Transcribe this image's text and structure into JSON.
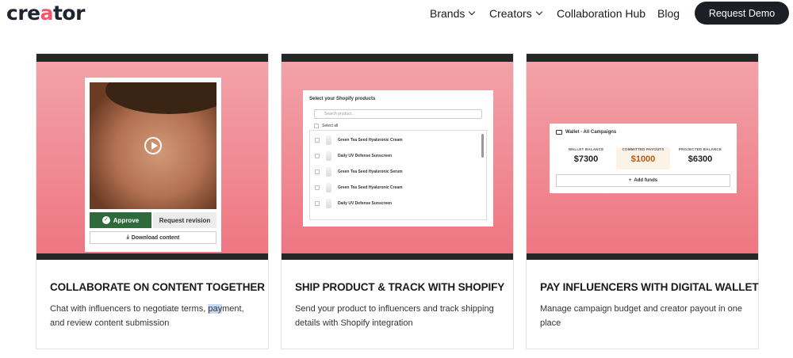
{
  "nav": {
    "logo_main": "cre",
    "logo_accent": "a",
    "logo_tail": "tor",
    "items": [
      {
        "label": "Brands",
        "dropdown": true
      },
      {
        "label": "Creators",
        "dropdown": true
      },
      {
        "label": "Collaboration Hub",
        "dropdown": false
      },
      {
        "label": "Blog",
        "dropdown": false
      }
    ],
    "cta": "Request Demo"
  },
  "cards": [
    {
      "title": "COLLABORATE ON CONTENT TOGETHER",
      "desc_before": "Chat with influencers to negotiate terms, ",
      "desc_highlight": "pay",
      "desc_after": "ment, and review content submission",
      "mock": {
        "approve": "Approve",
        "revise": "Request revision",
        "download": "Download content"
      }
    },
    {
      "title": "SHIP PRODUCT & TRACK WITH SHOPIFY",
      "desc": "Send your product to influencers and track shipping details with Shopify integration",
      "mock": {
        "heading": "Select your Shopify products",
        "search_placeholder": "Search product...",
        "select_all": "Select all",
        "products": [
          "Green Tea Seed Hyaluronic Cream",
          "Daily UV Defense Sunscreen",
          "Green Tea Seed Hyaluronic Serum",
          "Green Tea Seed Hyaluronic Cream",
          "Daily UV Defense Sunscreen"
        ]
      }
    },
    {
      "title": "PAY INFLUENCERS WITH DIGITAL WALLET",
      "desc": "Manage campaign budget and creator payout in one place",
      "mock": {
        "heading": "Wallet - All Campaigns",
        "balances": [
          {
            "label": "WALLET BALANCE",
            "amount": "$7300"
          },
          {
            "label": "COMMITTED PAYOUTS",
            "amount": "$1000"
          },
          {
            "label": "PROJECTED BALANCE",
            "amount": "$6300"
          }
        ],
        "add_funds": "Add funds"
      }
    }
  ],
  "colors": {
    "brand_accent": "#f0566e",
    "card_gradient_top": "#f2a2a8",
    "card_gradient_bottom": "#ee7682",
    "approve_green": "#2f6b3a",
    "cta_bg": "#1c1f26"
  }
}
